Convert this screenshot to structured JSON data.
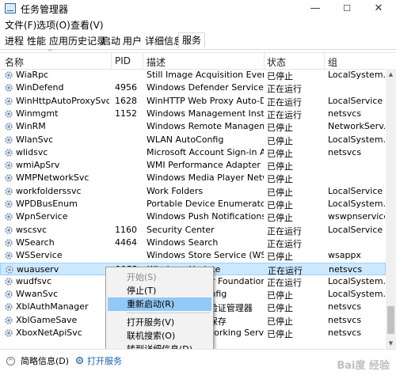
{
  "window": {
    "title": "任务管理器",
    "min": "—",
    "max": "☐",
    "close": "✕"
  },
  "menu": [
    "文件(F)",
    "选项(O)",
    "查看(V)"
  ],
  "tabs": [
    "进程",
    "性能",
    "应用历史记录",
    "启动",
    "用户",
    "详细信息",
    "服务"
  ],
  "active_tab": "服务",
  "columns": {
    "name": "名称",
    "pid": "PID",
    "desc": "描述",
    "status": "状态",
    "group": "组"
  },
  "rows": [
    {
      "name": "WiaRpc",
      "pid": "",
      "desc": "Still Image Acquisition Events",
      "status": "已停止",
      "group": "LocalSystem..."
    },
    {
      "name": "WinDefend",
      "pid": "4956",
      "desc": "Windows Defender Service",
      "status": "正在运行",
      "group": ""
    },
    {
      "name": "WinHttpAutoProxySvc",
      "pid": "1628",
      "desc": "WinHTTP Web Proxy Auto-Dis...",
      "status": "正在运行",
      "group": "LocalService"
    },
    {
      "name": "Winmgmt",
      "pid": "1152",
      "desc": "Windows Management Instru...",
      "status": "正在运行",
      "group": "netsvcs"
    },
    {
      "name": "WinRM",
      "pid": "",
      "desc": "Windows Remote Manageme...",
      "status": "已停止",
      "group": "NetworkServ..."
    },
    {
      "name": "WlanSvc",
      "pid": "",
      "desc": "WLAN AutoConfig",
      "status": "已停止",
      "group": "LocalSystem..."
    },
    {
      "name": "wlidsvc",
      "pid": "",
      "desc": "Microsoft Account Sign-in As...",
      "status": "已停止",
      "group": "netsvcs"
    },
    {
      "name": "wmiApSrv",
      "pid": "",
      "desc": "WMI Performance Adapter",
      "status": "已停止",
      "group": ""
    },
    {
      "name": "WMPNetworkSvc",
      "pid": "",
      "desc": "Windows Media Player Netw...",
      "status": "已停止",
      "group": ""
    },
    {
      "name": "workfolderssvc",
      "pid": "",
      "desc": "Work Folders",
      "status": "已停止",
      "group": "LocalService"
    },
    {
      "name": "WPDBusEnum",
      "pid": "",
      "desc": "Portable Device Enumerator ...",
      "status": "已停止",
      "group": "LocalSystem..."
    },
    {
      "name": "WpnService",
      "pid": "",
      "desc": "Windows Push Notifications S...",
      "status": "已停止",
      "group": "wswpnservice"
    },
    {
      "name": "wscsvc",
      "pid": "1160",
      "desc": "Security Center",
      "status": "正在运行",
      "group": "LocalService"
    },
    {
      "name": "WSearch",
      "pid": "4464",
      "desc": "Windows Search",
      "status": "正在运行",
      "group": ""
    },
    {
      "name": "WSService",
      "pid": "",
      "desc": "Windows Store Service (WSS...",
      "status": "已停止",
      "group": "wsappx"
    },
    {
      "name": "wuauserv",
      "pid": "1152",
      "desc": "Windows Update",
      "status": "正在运行",
      "group": "netsvcs"
    },
    {
      "name": "wudfsvc",
      "pid": "",
      "desc": "Windows Driver Foundation -...",
      "status": "正在运行",
      "group": "LocalSystem..."
    },
    {
      "name": "WwanSvc",
      "pid": "",
      "desc": "WWAN AutoConfig",
      "status": "已停止",
      "group": "LocalSystem..."
    },
    {
      "name": "XblAuthManager",
      "pid": "",
      "desc": "Xbox Live 身份验证管理器",
      "status": "已停止",
      "group": "netsvcs"
    },
    {
      "name": "XblGameSave",
      "pid": "",
      "desc": "Xbox Live 游戏保存",
      "status": "已停止",
      "group": "netsvcs"
    },
    {
      "name": "XboxNetApiSvc",
      "pid": "",
      "desc": "Xbox Live Networking Service",
      "status": "已停止",
      "group": "netsvcs"
    }
  ],
  "context_menu": [
    {
      "label": "开始(S)",
      "disabled": true
    },
    {
      "label": "停止(T)",
      "disabled": false
    },
    {
      "label": "重新启动(R)",
      "disabled": false,
      "hover": true
    },
    {
      "label": "打开服务(V)",
      "disabled": false
    },
    {
      "label": "联机搜索(O)",
      "disabled": false
    },
    {
      "label": "转到详细信息(D)",
      "disabled": false
    }
  ],
  "statusbar": {
    "less_details": "简略信息(D)",
    "open_services": "打开服务"
  },
  "watermark": "Bai度 经验",
  "colors": {
    "selected_row_bg": "#cce8ff",
    "menu_hover": "#91c9f7",
    "link": "#1a5fb4"
  },
  "icons": {
    "service": "gear-icon",
    "collapse": "chevron-up-icon"
  }
}
